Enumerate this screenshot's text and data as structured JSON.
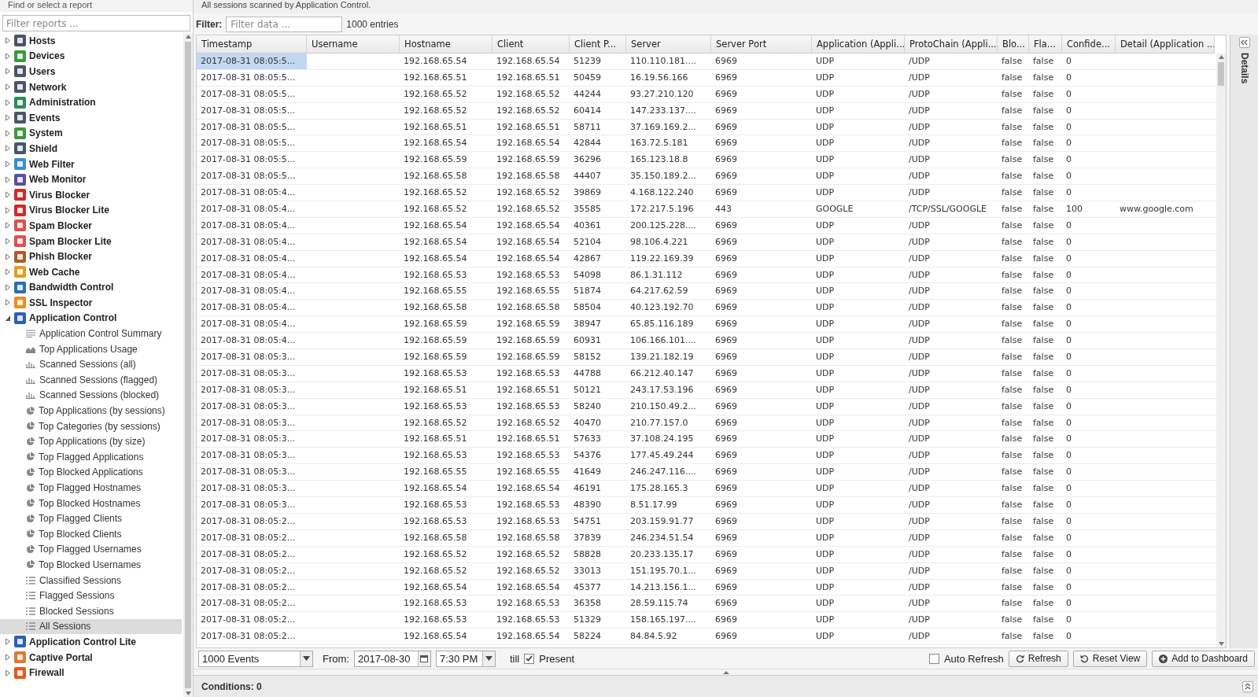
{
  "sidebar": {
    "title": "Find or select a report",
    "placeholder": "Filter reports ...",
    "items": [
      {
        "label": "Hosts",
        "color": "#4a5568",
        "expanded": false,
        "selected": false
      },
      {
        "label": "Devices",
        "color": "#3c9a3c",
        "expanded": false,
        "selected": false
      },
      {
        "label": "Users",
        "color": "#4a5568",
        "expanded": false,
        "selected": false
      },
      {
        "label": "Network",
        "color": "#4a5568",
        "expanded": false,
        "selected": false
      },
      {
        "label": "Administration",
        "color": "#2e8b57",
        "expanded": false,
        "selected": false
      },
      {
        "label": "Events",
        "color": "#4a5568",
        "expanded": false,
        "selected": false
      },
      {
        "label": "System",
        "color": "#3c9a3c",
        "expanded": false,
        "selected": false
      },
      {
        "label": "Shield",
        "color": "#4a5568",
        "expanded": false,
        "selected": false
      },
      {
        "label": "Web Filter",
        "color": "#3a8fd0",
        "expanded": false,
        "selected": false
      },
      {
        "label": "Web Monitor",
        "color": "#5a4fa0",
        "expanded": false,
        "selected": false
      },
      {
        "label": "Virus Blocker",
        "color": "#d02a2a",
        "expanded": false,
        "selected": false
      },
      {
        "label": "Virus Blocker Lite",
        "color": "#d02a2a",
        "expanded": false,
        "selected": false
      },
      {
        "label": "Spam Blocker",
        "color": "#d9534f",
        "expanded": false,
        "selected": false
      },
      {
        "label": "Spam Blocker Lite",
        "color": "#d9534f",
        "expanded": false,
        "selected": false
      },
      {
        "label": "Phish Blocker",
        "color": "#b05a2a",
        "expanded": false,
        "selected": false
      },
      {
        "label": "Web Cache",
        "color": "#e0a020",
        "expanded": false,
        "selected": false
      },
      {
        "label": "Bandwidth Control",
        "color": "#2a6fb0",
        "expanded": false,
        "selected": false
      },
      {
        "label": "SSL Inspector",
        "color": "#f08a20",
        "expanded": false,
        "selected": false
      },
      {
        "label": "Application Control",
        "color": "#2a5fc0",
        "expanded": true,
        "selected": false,
        "children": [
          {
            "label": "Application Control Summary",
            "kind": "text",
            "selected": false
          },
          {
            "label": "Top Applications Usage",
            "kind": "area",
            "selected": false
          },
          {
            "label": "Scanned Sessions (all)",
            "kind": "bar",
            "selected": false
          },
          {
            "label": "Scanned Sessions (flagged)",
            "kind": "bar",
            "selected": false
          },
          {
            "label": "Scanned Sessions (blocked)",
            "kind": "bar",
            "selected": false
          },
          {
            "label": "Top Applications (by sessions)",
            "kind": "pie",
            "selected": false
          },
          {
            "label": "Top Categories (by sessions)",
            "kind": "pie",
            "selected": false
          },
          {
            "label": "Top Applications (by size)",
            "kind": "pie",
            "selected": false
          },
          {
            "label": "Top Flagged Applications",
            "kind": "pie",
            "selected": false
          },
          {
            "label": "Top Blocked Applications",
            "kind": "pie",
            "selected": false
          },
          {
            "label": "Top Flagged Hostnames",
            "kind": "pie",
            "selected": false
          },
          {
            "label": "Top Blocked Hostnames",
            "kind": "pie",
            "selected": false
          },
          {
            "label": "Top Flagged Clients",
            "kind": "pie",
            "selected": false
          },
          {
            "label": "Top Blocked Clients",
            "kind": "pie",
            "selected": false
          },
          {
            "label": "Top Flagged Usernames",
            "kind": "pie",
            "selected": false
          },
          {
            "label": "Top Blocked Usernames",
            "kind": "pie",
            "selected": false
          },
          {
            "label": "Classified Sessions",
            "kind": "list",
            "selected": false
          },
          {
            "label": "Flagged Sessions",
            "kind": "list",
            "selected": false
          },
          {
            "label": "Blocked Sessions",
            "kind": "list",
            "selected": false
          },
          {
            "label": "All Sessions",
            "kind": "list",
            "selected": true
          }
        ]
      },
      {
        "label": "Application Control Lite",
        "color": "#2a5fc0",
        "expanded": false,
        "selected": false
      },
      {
        "label": "Captive Portal",
        "color": "#e07a30",
        "expanded": false,
        "selected": false
      },
      {
        "label": "Firewall",
        "color": "#e05a20",
        "expanded": false,
        "selected": false
      }
    ]
  },
  "description": "All sessions scanned by Application Control.",
  "filter": {
    "label": "Filter:",
    "placeholder": "Filter data ...",
    "count": "1000 entries"
  },
  "table": {
    "columns": [
      "Timestamp",
      "Username",
      "Hostname",
      "Client",
      "Client P...",
      "Server",
      "Server Port",
      "Application (Appli...",
      "ProtoChain (Appli...",
      "Blo...",
      "Fla...",
      "Confide...",
      "Detail (Application ..."
    ],
    "rows": [
      {
        "selected": true,
        "timestamp": "2017-08-31 08:05:5...",
        "hostname": "192.168.65.54",
        "client": "192.168.65.54",
        "client_port": "51239",
        "server": "110.110.181....",
        "server_port": "6969",
        "application": "UDP",
        "protochain": "/UDP",
        "blocked": "false",
        "flagged": "false",
        "confidence": "0"
      },
      {
        "selected": false,
        "timestamp": "2017-08-31 08:05:5...",
        "hostname": "192.168.65.51",
        "client": "192.168.65.51",
        "client_port": "50459",
        "server": "16.19.56.166",
        "server_port": "6969",
        "application": "UDP",
        "protochain": "/UDP",
        "blocked": "false",
        "flagged": "false",
        "confidence": "0"
      },
      {
        "selected": false,
        "timestamp": "2017-08-31 08:05:5...",
        "hostname": "192.168.65.52",
        "client": "192.168.65.52",
        "client_port": "44244",
        "server": "93.27.210.120",
        "server_port": "6969",
        "application": "UDP",
        "protochain": "/UDP",
        "blocked": "false",
        "flagged": "false",
        "confidence": "0"
      },
      {
        "selected": false,
        "timestamp": "2017-08-31 08:05:5...",
        "hostname": "192.168.65.52",
        "client": "192.168.65.52",
        "client_port": "60414",
        "server": "147.233.137....",
        "server_port": "6969",
        "application": "UDP",
        "protochain": "/UDP",
        "blocked": "false",
        "flagged": "false",
        "confidence": "0"
      },
      {
        "selected": false,
        "timestamp": "2017-08-31 08:05:5...",
        "hostname": "192.168.65.51",
        "client": "192.168.65.51",
        "client_port": "58711",
        "server": "37.169.169.2...",
        "server_port": "6969",
        "application": "UDP",
        "protochain": "/UDP",
        "blocked": "false",
        "flagged": "false",
        "confidence": "0"
      },
      {
        "selected": false,
        "timestamp": "2017-08-31 08:05:5...",
        "hostname": "192.168.65.54",
        "client": "192.168.65.54",
        "client_port": "42844",
        "server": "163.72.5.181",
        "server_port": "6969",
        "application": "UDP",
        "protochain": "/UDP",
        "blocked": "false",
        "flagged": "false",
        "confidence": "0"
      },
      {
        "selected": false,
        "timestamp": "2017-08-31 08:05:5...",
        "hostname": "192.168.65.59",
        "client": "192.168.65.59",
        "client_port": "36296",
        "server": "165.123.18.8",
        "server_port": "6969",
        "application": "UDP",
        "protochain": "/UDP",
        "blocked": "false",
        "flagged": "false",
        "confidence": "0"
      },
      {
        "selected": false,
        "timestamp": "2017-08-31 08:05:5...",
        "hostname": "192.168.65.58",
        "client": "192.168.65.58",
        "client_port": "44407",
        "server": "35.150.189.2...",
        "server_port": "6969",
        "application": "UDP",
        "protochain": "/UDP",
        "blocked": "false",
        "flagged": "false",
        "confidence": "0"
      },
      {
        "selected": false,
        "timestamp": "2017-08-31 08:05:4...",
        "hostname": "192.168.65.52",
        "client": "192.168.65.52",
        "client_port": "39869",
        "server": "4.168.122.240",
        "server_port": "6969",
        "application": "UDP",
        "protochain": "/UDP",
        "blocked": "false",
        "flagged": "false",
        "confidence": "0"
      },
      {
        "selected": false,
        "timestamp": "2017-08-31 08:05:4...",
        "hostname": "192.168.65.52",
        "client": "192.168.65.52",
        "client_port": "35585",
        "server": "172.217.5.196",
        "server_port": "443",
        "application": "GOOGLE",
        "protochain": "/TCP/SSL/GOOGLE",
        "blocked": "false",
        "flagged": "false",
        "confidence": "100",
        "detail": "www.google.com"
      },
      {
        "selected": false,
        "timestamp": "2017-08-31 08:05:4...",
        "hostname": "192.168.65.54",
        "client": "192.168.65.54",
        "client_port": "40361",
        "server": "200.125.228....",
        "server_port": "6969",
        "application": "UDP",
        "protochain": "/UDP",
        "blocked": "false",
        "flagged": "false",
        "confidence": "0"
      },
      {
        "selected": false,
        "timestamp": "2017-08-31 08:05:4...",
        "hostname": "192.168.65.54",
        "client": "192.168.65.54",
        "client_port": "52104",
        "server": "98.106.4.221",
        "server_port": "6969",
        "application": "UDP",
        "protochain": "/UDP",
        "blocked": "false",
        "flagged": "false",
        "confidence": "0"
      },
      {
        "selected": false,
        "timestamp": "2017-08-31 08:05:4...",
        "hostname": "192.168.65.54",
        "client": "192.168.65.54",
        "client_port": "42867",
        "server": "119.22.169.39",
        "server_port": "6969",
        "application": "UDP",
        "protochain": "/UDP",
        "blocked": "false",
        "flagged": "false",
        "confidence": "0"
      },
      {
        "selected": false,
        "timestamp": "2017-08-31 08:05:4...",
        "hostname": "192.168.65.53",
        "client": "192.168.65.53",
        "client_port": "54098",
        "server": "86.1.31.112",
        "server_port": "6969",
        "application": "UDP",
        "protochain": "/UDP",
        "blocked": "false",
        "flagged": "false",
        "confidence": "0"
      },
      {
        "selected": false,
        "timestamp": "2017-08-31 08:05:4...",
        "hostname": "192.168.65.55",
        "client": "192.168.65.55",
        "client_port": "51874",
        "server": "64.217.62.59",
        "server_port": "6969",
        "application": "UDP",
        "protochain": "/UDP",
        "blocked": "false",
        "flagged": "false",
        "confidence": "0"
      },
      {
        "selected": false,
        "timestamp": "2017-08-31 08:05:4...",
        "hostname": "192.168.65.58",
        "client": "192.168.65.58",
        "client_port": "58504",
        "server": "40.123.192.70",
        "server_port": "6969",
        "application": "UDP",
        "protochain": "/UDP",
        "blocked": "false",
        "flagged": "false",
        "confidence": "0"
      },
      {
        "selected": false,
        "timestamp": "2017-08-31 08:05:4...",
        "hostname": "192.168.65.59",
        "client": "192.168.65.59",
        "client_port": "38947",
        "server": "65.85.116.189",
        "server_port": "6969",
        "application": "UDP",
        "protochain": "/UDP",
        "blocked": "false",
        "flagged": "false",
        "confidence": "0"
      },
      {
        "selected": false,
        "timestamp": "2017-08-31 08:05:4...",
        "hostname": "192.168.65.59",
        "client": "192.168.65.59",
        "client_port": "60931",
        "server": "106.166.101....",
        "server_port": "6969",
        "application": "UDP",
        "protochain": "/UDP",
        "blocked": "false",
        "flagged": "false",
        "confidence": "0"
      },
      {
        "selected": false,
        "timestamp": "2017-08-31 08:05:3...",
        "hostname": "192.168.65.59",
        "client": "192.168.65.59",
        "client_port": "58152",
        "server": "139.21.182.19",
        "server_port": "6969",
        "application": "UDP",
        "protochain": "/UDP",
        "blocked": "false",
        "flagged": "false",
        "confidence": "0"
      },
      {
        "selected": false,
        "timestamp": "2017-08-31 08:05:3...",
        "hostname": "192.168.65.53",
        "client": "192.168.65.53",
        "client_port": "44788",
        "server": "66.212.40.147",
        "server_port": "6969",
        "application": "UDP",
        "protochain": "/UDP",
        "blocked": "false",
        "flagged": "false",
        "confidence": "0"
      },
      {
        "selected": false,
        "timestamp": "2017-08-31 08:05:3...",
        "hostname": "192.168.65.51",
        "client": "192.168.65.51",
        "client_port": "50121",
        "server": "243.17.53.196",
        "server_port": "6969",
        "application": "UDP",
        "protochain": "/UDP",
        "blocked": "false",
        "flagged": "false",
        "confidence": "0"
      },
      {
        "selected": false,
        "timestamp": "2017-08-31 08:05:3...",
        "hostname": "192.168.65.53",
        "client": "192.168.65.53",
        "client_port": "58240",
        "server": "210.150.49.2...",
        "server_port": "6969",
        "application": "UDP",
        "protochain": "/UDP",
        "blocked": "false",
        "flagged": "false",
        "confidence": "0"
      },
      {
        "selected": false,
        "timestamp": "2017-08-31 08:05:3...",
        "hostname": "192.168.65.52",
        "client": "192.168.65.52",
        "client_port": "40470",
        "server": "210.77.157.0",
        "server_port": "6969",
        "application": "UDP",
        "protochain": "/UDP",
        "blocked": "false",
        "flagged": "false",
        "confidence": "0"
      },
      {
        "selected": false,
        "timestamp": "2017-08-31 08:05:3...",
        "hostname": "192.168.65.51",
        "client": "192.168.65.51",
        "client_port": "57633",
        "server": "37.108.24.195",
        "server_port": "6969",
        "application": "UDP",
        "protochain": "/UDP",
        "blocked": "false",
        "flagged": "false",
        "confidence": "0"
      },
      {
        "selected": false,
        "timestamp": "2017-08-31 08:05:3...",
        "hostname": "192.168.65.53",
        "client": "192.168.65.53",
        "client_port": "54376",
        "server": "177.45.49.244",
        "server_port": "6969",
        "application": "UDP",
        "protochain": "/UDP",
        "blocked": "false",
        "flagged": "false",
        "confidence": "0"
      },
      {
        "selected": false,
        "timestamp": "2017-08-31 08:05:3...",
        "hostname": "192.168.65.55",
        "client": "192.168.65.55",
        "client_port": "41649",
        "server": "246.247.116....",
        "server_port": "6969",
        "application": "UDP",
        "protochain": "/UDP",
        "blocked": "false",
        "flagged": "false",
        "confidence": "0"
      },
      {
        "selected": false,
        "timestamp": "2017-08-31 08:05:3...",
        "hostname": "192.168.65.54",
        "client": "192.168.65.54",
        "client_port": "46191",
        "server": "175.28.165.3",
        "server_port": "6969",
        "application": "UDP",
        "protochain": "/UDP",
        "blocked": "false",
        "flagged": "false",
        "confidence": "0"
      },
      {
        "selected": false,
        "timestamp": "2017-08-31 08:05:3...",
        "hostname": "192.168.65.53",
        "client": "192.168.65.53",
        "client_port": "48390",
        "server": "8.51.17.99",
        "server_port": "6969",
        "application": "UDP",
        "protochain": "/UDP",
        "blocked": "false",
        "flagged": "false",
        "confidence": "0"
      },
      {
        "selected": false,
        "timestamp": "2017-08-31 08:05:2...",
        "hostname": "192.168.65.53",
        "client": "192.168.65.53",
        "client_port": "54751",
        "server": "203.159.91.77",
        "server_port": "6969",
        "application": "UDP",
        "protochain": "/UDP",
        "blocked": "false",
        "flagged": "false",
        "confidence": "0"
      },
      {
        "selected": false,
        "timestamp": "2017-08-31 08:05:2...",
        "hostname": "192.168.65.58",
        "client": "192.168.65.58",
        "client_port": "37839",
        "server": "246.234.51.54",
        "server_port": "6969",
        "application": "UDP",
        "protochain": "/UDP",
        "blocked": "false",
        "flagged": "false",
        "confidence": "0"
      },
      {
        "selected": false,
        "timestamp": "2017-08-31 08:05:2...",
        "hostname": "192.168.65.52",
        "client": "192.168.65.52",
        "client_port": "58828",
        "server": "20.233.135.17",
        "server_port": "6969",
        "application": "UDP",
        "protochain": "/UDP",
        "blocked": "false",
        "flagged": "false",
        "confidence": "0"
      },
      {
        "selected": false,
        "timestamp": "2017-08-31 08:05:2...",
        "hostname": "192.168.65.52",
        "client": "192.168.65.52",
        "client_port": "33013",
        "server": "151.195.70.1...",
        "server_port": "6969",
        "application": "UDP",
        "protochain": "/UDP",
        "blocked": "false",
        "flagged": "false",
        "confidence": "0"
      },
      {
        "selected": false,
        "timestamp": "2017-08-31 08:05:2...",
        "hostname": "192.168.65.54",
        "client": "192.168.65.54",
        "client_port": "45377",
        "server": "14.213.156.1...",
        "server_port": "6969",
        "application": "UDP",
        "protochain": "/UDP",
        "blocked": "false",
        "flagged": "false",
        "confidence": "0"
      },
      {
        "selected": false,
        "timestamp": "2017-08-31 08:05:2...",
        "hostname": "192.168.65.53",
        "client": "192.168.65.53",
        "client_port": "36358",
        "server": "28.59.115.74",
        "server_port": "6969",
        "application": "UDP",
        "protochain": "/UDP",
        "blocked": "false",
        "flagged": "false",
        "confidence": "0"
      },
      {
        "selected": false,
        "timestamp": "2017-08-31 08:05:2...",
        "hostname": "192.168.65.53",
        "client": "192.168.65.53",
        "client_port": "51329",
        "server": "158.165.197....",
        "server_port": "6969",
        "application": "UDP",
        "protochain": "/UDP",
        "blocked": "false",
        "flagged": "false",
        "confidence": "0"
      },
      {
        "selected": false,
        "timestamp": "2017-08-31 08:05:2...",
        "hostname": "192.168.65.54",
        "client": "192.168.65.54",
        "client_port": "58224",
        "server": "84.84.5.92",
        "server_port": "6969",
        "application": "UDP",
        "protochain": "/UDP",
        "blocked": "false",
        "flagged": "false",
        "confidence": "0"
      }
    ]
  },
  "details_panel": {
    "title": "Details"
  },
  "toolbar": {
    "limit": "1000 Events",
    "from_label": "From:",
    "date": "2017-08-30",
    "time": "7:30 PM",
    "till_label": "till",
    "present": {
      "label": "Present",
      "checked": true
    },
    "auto_refresh": {
      "label": "Auto Refresh",
      "checked": false
    },
    "buttons": [
      {
        "label": "Refresh",
        "kind": "refresh"
      },
      {
        "label": "Reset View",
        "kind": "reset"
      },
      {
        "label": "Add to Dashboard",
        "kind": "add"
      }
    ]
  },
  "conditions": "Conditions: 0"
}
